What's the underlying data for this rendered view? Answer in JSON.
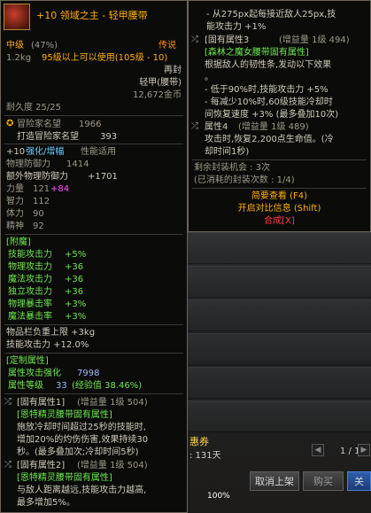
{
  "item": {
    "title": "+10 领域之主 - 轻甲腰带",
    "grade": "中级",
    "grade_pct": "(47%)",
    "rarity": "传说",
    "weight": "1.2kg",
    "level_req": "95级以上可以使用(105级 - 10)",
    "trade": "再封",
    "type": "轻甲(腰带)",
    "price": "12,672金币",
    "durability": "耐久度 25/25",
    "adventurer_label": "冒险家名望",
    "adventurer_value": "1966",
    "forge_label": "打造冒险家名望",
    "forge_value": "393",
    "enhance_plus": "+10",
    "enhance_label": "强化/增幅",
    "enhance_note": "性能适用",
    "stats": [
      {
        "name": "物理防御力",
        "value": "1414",
        "extra": ""
      },
      {
        "name": "额外物理防御力",
        "value": "+1701",
        "extra": ""
      },
      {
        "name": "力量",
        "value": "121",
        "extra": "+84"
      },
      {
        "name": "智力",
        "value": "112",
        "extra": ""
      },
      {
        "name": "体力",
        "value": "90",
        "extra": ""
      },
      {
        "name": "精神",
        "value": "92",
        "extra": ""
      }
    ],
    "enchant_title": "[附魔]",
    "enchants": [
      {
        "name": "技能攻击力",
        "value": "+5%"
      },
      {
        "name": "物理攻击力",
        "value": "+36"
      },
      {
        "name": "魔法攻击力",
        "value": "+36"
      },
      {
        "name": "独立攻击力",
        "value": "+36"
      },
      {
        "name": "物理暴击率",
        "value": "+3%"
      },
      {
        "name": "魔法暴击率",
        "value": "+3%"
      }
    ],
    "extra_weight": "物品栏负重上限 +3kg",
    "extra_skill": "技能攻击力 +12.0%",
    "custom_title": "[定制属性]",
    "custom_1_label": "属性攻击强化",
    "custom_1_value": "7998",
    "custom_2_label": "属性等级",
    "custom_2_value": "33",
    "custom_2_note": "(经验值 38.46%)",
    "fixed1_title": "[固有属性1]",
    "fixed1_meta": "(增益量 1级 504)",
    "fixed1_source": "[恩特精灵腰带固有属性]",
    "fixed1_desc": [
      "施放冷却时间超过25秒的技能时,",
      "增加20%的灼伤伤害,效果持续30",
      "秒。(最多叠加次;冷却时间5秒)"
    ],
    "fixed2_title": "[固有属性2]",
    "fixed2_meta": "(增益量 1级 504)",
    "fixed2_source": "[恩特精灵腰带固有属性]",
    "fixed2_desc": [
      "与敌人距离越远,技能攻击力越高,",
      "最多增加5%。"
    ]
  },
  "right": {
    "lines_top": [
      "- 从275px起每接近敌人25px,技",
      "能攻击力 +1%"
    ],
    "fixed3_title": "[固有属性3",
    "fixed3_meta": "(增益量 1级 494)",
    "fixed3_source": "[森林之魔女腰带固有属性]",
    "fixed3_desc": [
      "根据敌人的韧性条,发动以下效果",
      "。",
      "- 低于90%时,技能攻击力 +5%",
      "- 每减少10%时,60级技能冷却时",
      "间恢复速度 +3% (最多叠加10次)"
    ],
    "attr4_title": "属性4",
    "attr4_meta": "(增益量 1级 489)",
    "attr4_desc": [
      "攻击时,恢复2,200点生命值。(冷",
      "却时间1秒)"
    ],
    "seal_remaining": "剩余封装机会 : 3次",
    "seal_used": "(已消耗的封装次数 : 1/4)",
    "menu_simple": "简要查看 (F4)",
    "menu_compare": "开启对比信息 (Shift)",
    "menu_compose": "合成[X]"
  },
  "background": {
    "coupon_label": "惠券",
    "days": ": 131天",
    "page": "1 / 1",
    "pct": "100%",
    "cancel_btn": "取消上架",
    "buy_btn": "购买",
    "extra_btn": "关"
  },
  "colors": {
    "legendary": "#ff8a00",
    "title_gold": "#ffb000",
    "green_stat": "#6ee84f",
    "blue_stat": "#66ccff",
    "pink_stat": "#ff55ff"
  }
}
